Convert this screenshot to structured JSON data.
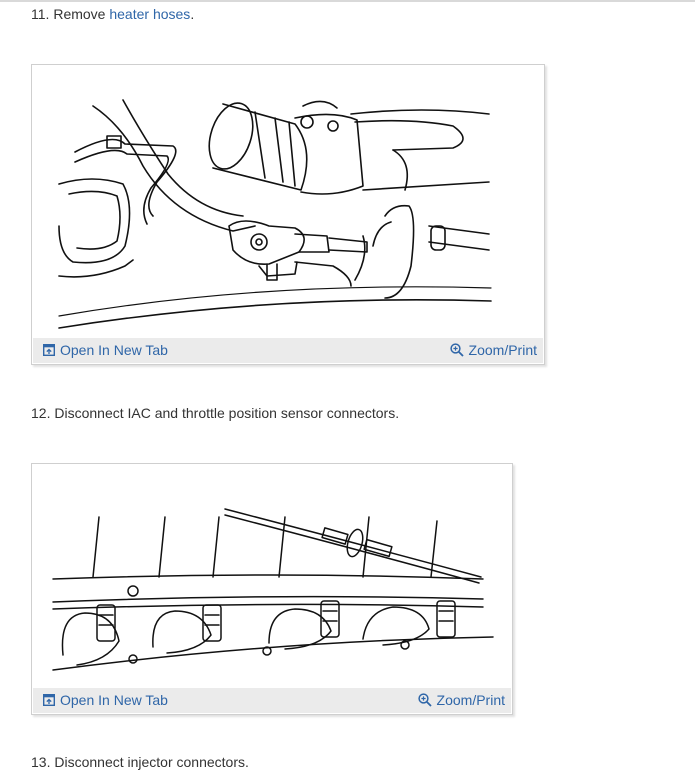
{
  "steps": [
    {
      "number": "11.",
      "text_before": "Remove ",
      "link": "heater hoses",
      "text_after": "."
    },
    {
      "number": "12.",
      "text": "Disconnect IAC and throttle position sensor connectors."
    },
    {
      "number": "13.",
      "text": "Disconnect injector connectors."
    }
  ],
  "figures": [
    {
      "open_label": "Open In New Tab",
      "zoom_label": "Zoom/Print",
      "open_icon": "open-in-new-tab-icon",
      "zoom_icon": "zoom-magnifier-icon"
    },
    {
      "open_label": "Open In New Tab",
      "zoom_label": "Zoom/Print",
      "open_icon": "open-in-new-tab-icon",
      "zoom_icon": "zoom-magnifier-icon"
    }
  ],
  "colors": {
    "link": "#2f66a8",
    "text": "#333333",
    "toolbar": "#ebebeb",
    "border": "#cfcfcf"
  }
}
